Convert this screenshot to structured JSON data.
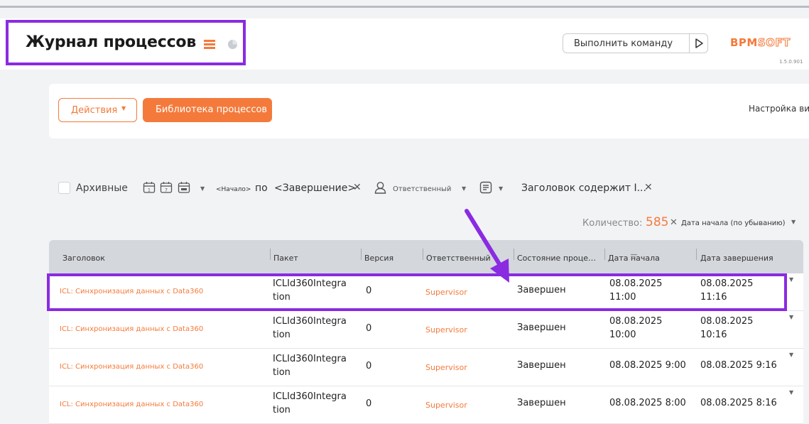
{
  "header": {
    "title": "Журнал процессов",
    "command_label": "Выполнить команду",
    "logo_part1": "BPM",
    "logo_part2": "SOFT",
    "version": "1.5.0.901"
  },
  "toolbar": {
    "actions_label": "Действия",
    "library_label": "Библиотека процессов",
    "view_settings": "Настройка вид"
  },
  "filters": {
    "archive_label": "Архивные",
    "period_start": "<Начало>",
    "period_to": "по",
    "period_end": "<Завершение>",
    "responsible": "Ответственный",
    "title_filter": "Заголовок содержит I..."
  },
  "summary": {
    "count_label": "Количество:",
    "count_value": "585",
    "sort_label": "Дата начала (по убыванию)"
  },
  "table": {
    "columns": [
      "Заголовок",
      "Пакет",
      "Версия",
      "Ответственный",
      "Состояние проце…",
      "Дата начала",
      "Дата завершения"
    ],
    "rows": [
      {
        "title": "ICL: Синхронизация данных с Data360",
        "package_1": "ICLId360Integra",
        "package_2": "tion",
        "version": "0",
        "responsible": "Supervisor",
        "state": "Завершен",
        "start_1": "08.08.2025",
        "start_2": "11:00",
        "end_1": "08.08.2025",
        "end_2": "11:16"
      },
      {
        "title": "ICL: Синхронизация данных с Data360",
        "package_1": "ICLId360Integra",
        "package_2": "tion",
        "version": "0",
        "responsible": "Supervisor",
        "state": "Завершен",
        "start_1": "08.08.2025",
        "start_2": "10:00",
        "end_1": "08.08.2025",
        "end_2": "10:16"
      },
      {
        "title": "ICL: Синхронизация данных с Data360",
        "package_1": "ICLId360Integra",
        "package_2": "tion",
        "version": "0",
        "responsible": "Supervisor",
        "state": "Завершен",
        "start": "08.08.2025 9:00",
        "end": "08.08.2025 9:16"
      },
      {
        "title": "ICL: Синхронизация данных с Data360",
        "package_1": "ICLId360Integra",
        "package_2": "tion",
        "version": "0",
        "responsible": "Supervisor",
        "state": "Завершен",
        "start": "08.08.2025 8:00",
        "end": "08.08.2025 8:16"
      }
    ]
  },
  "colors": {
    "accent": "#f47a3b",
    "annotation": "#8a2be2"
  }
}
